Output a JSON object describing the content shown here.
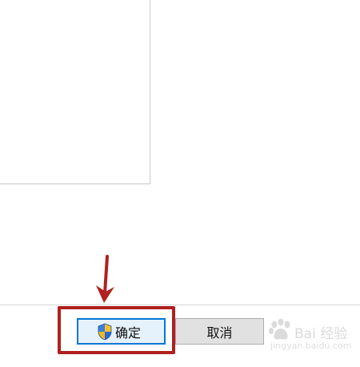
{
  "dialog": {
    "ok_label": "确定",
    "cancel_label": "取消"
  },
  "icons": {
    "ok_icon": "uac-shield-icon",
    "annotation_arrow": "arrow-down-icon"
  },
  "annotation": {
    "highlight_color": "#b0201e"
  },
  "watermark": {
    "brand_text": "Bai 经验",
    "url": "jingyan.baidu.com"
  },
  "colors": {
    "ok_border": "#0078d7",
    "ok_background": "#e5f1fb",
    "cancel_background": "#e1e1e1"
  }
}
